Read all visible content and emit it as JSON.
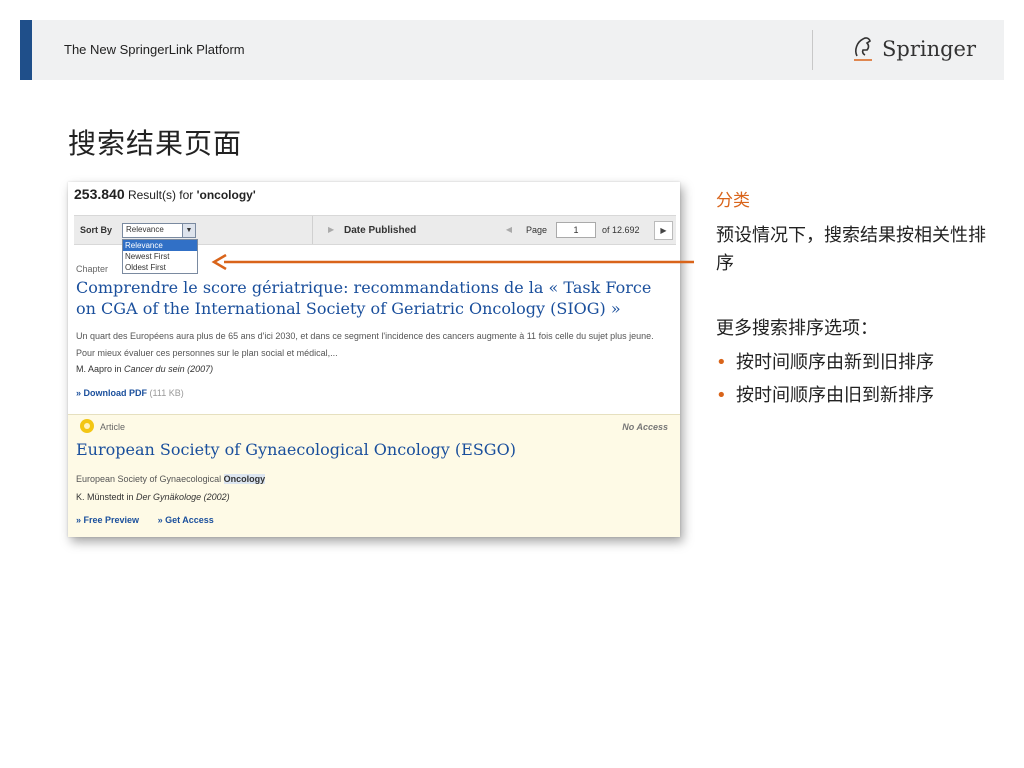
{
  "header": {
    "title": "The New SpringerLink Platform",
    "logo_text": "Springer"
  },
  "slide_title": "搜索结果页面",
  "screenshot": {
    "result_count": "253.840",
    "result_text": "Result(s) for",
    "query": "'oncology'",
    "sort_label": "Sort By",
    "sort_value": "Relevance",
    "sort_options": [
      "Relevance",
      "Newest First",
      "Oldest First"
    ],
    "date_label": "Date Published",
    "page_label": "Page",
    "page_value": "1",
    "page_total": "of 12.692",
    "result1": {
      "type": "Chapter",
      "title": "Comprendre le score gériatrique: recommandations de la « Task Force on CGA of the International Society of Geriatric Oncology (SIOG) »",
      "snippet": "Un quart des Européens aura plus de 65 ans d'ici 2030, et dans ce segment l'incidence des cancers augmente à 11 fois celle du sujet plus jeune. Pour mieux évaluer ces personnes sur le plan social et médical,...",
      "author": "M. Aapro in",
      "source": "Cancer du sein (2007)",
      "download_label": "» Download PDF",
      "download_size": "(111 KB)"
    },
    "result2": {
      "type": "Article",
      "access": "No Access",
      "title": "European Society of Gynaecological Oncology (ESGO)",
      "snippet_prefix": "European Society of Gynaecological",
      "snippet_highlight": "Oncology",
      "author": "K. Münstedt in",
      "source": "Der Gynäkologe (2002)",
      "preview_label": "» Free Preview",
      "access_label": "» Get Access"
    }
  },
  "side": {
    "category": "分类",
    "description": "预设情况下，搜索结果按相关性排序",
    "more_options": "更多搜索排序选项：",
    "bullets": [
      "按时间顺序由新到旧排序",
      "按时间顺序由旧到新排序"
    ]
  },
  "colors": {
    "accent_orange": "#d9641a",
    "link_blue": "#1a4f9c",
    "header_accent": "#1f4f8a"
  }
}
